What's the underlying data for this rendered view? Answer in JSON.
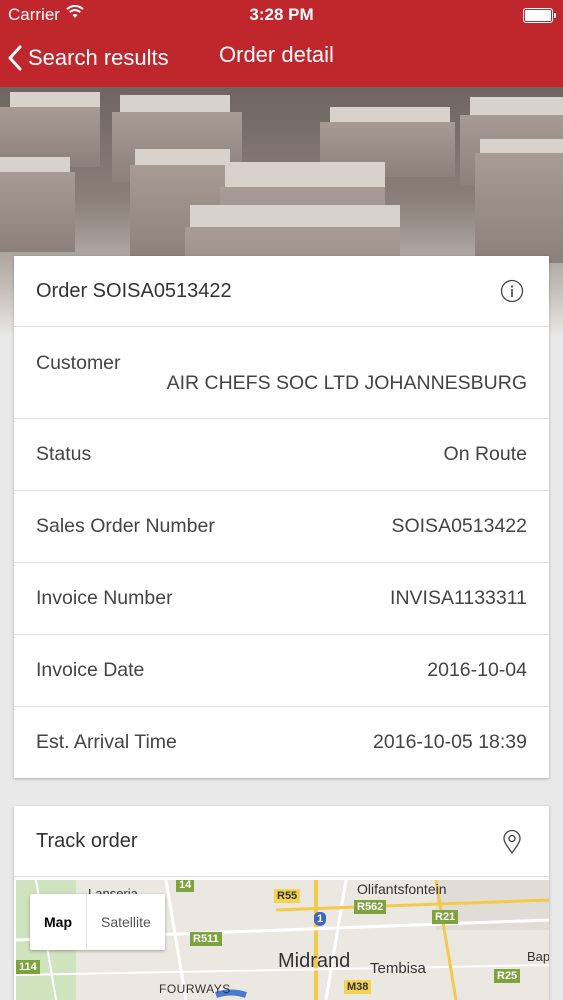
{
  "status_bar": {
    "carrier": "Carrier",
    "time": "3:28 PM"
  },
  "nav": {
    "back_label": "Search results",
    "title": "Order detail"
  },
  "order_card": {
    "title": "Order SOISA0513422",
    "rows": [
      {
        "label": "Customer",
        "value": "AIR CHEFS SOC LTD JOHANNESBURG"
      },
      {
        "label": "Status",
        "value": "On Route"
      },
      {
        "label": "Sales Order Number",
        "value": "SOISA0513422"
      },
      {
        "label": "Invoice Number",
        "value": "INVISA1133311"
      },
      {
        "label": "Invoice Date",
        "value": "2016-10-04"
      },
      {
        "label": "Est. Arrival Time",
        "value": "2016-10-05 18:39"
      }
    ]
  },
  "track_card": {
    "title": "Track order"
  },
  "map": {
    "type_control": {
      "map": "Map",
      "satellite": "Satellite"
    },
    "places": {
      "lanseria": "Lanseria",
      "olifantsfontein": "Olifantsfontein",
      "midrand": "Midrand",
      "tembisa": "Tembisa",
      "fourways": "FOURWAYS",
      "bap": "Bap"
    },
    "roads": {
      "r14": "14",
      "r55": "R55",
      "n1": "1",
      "r562": "R562",
      "r21": "R21",
      "r511": "R511",
      "r114": "114",
      "m38": "M38",
      "r25": "R25"
    }
  }
}
